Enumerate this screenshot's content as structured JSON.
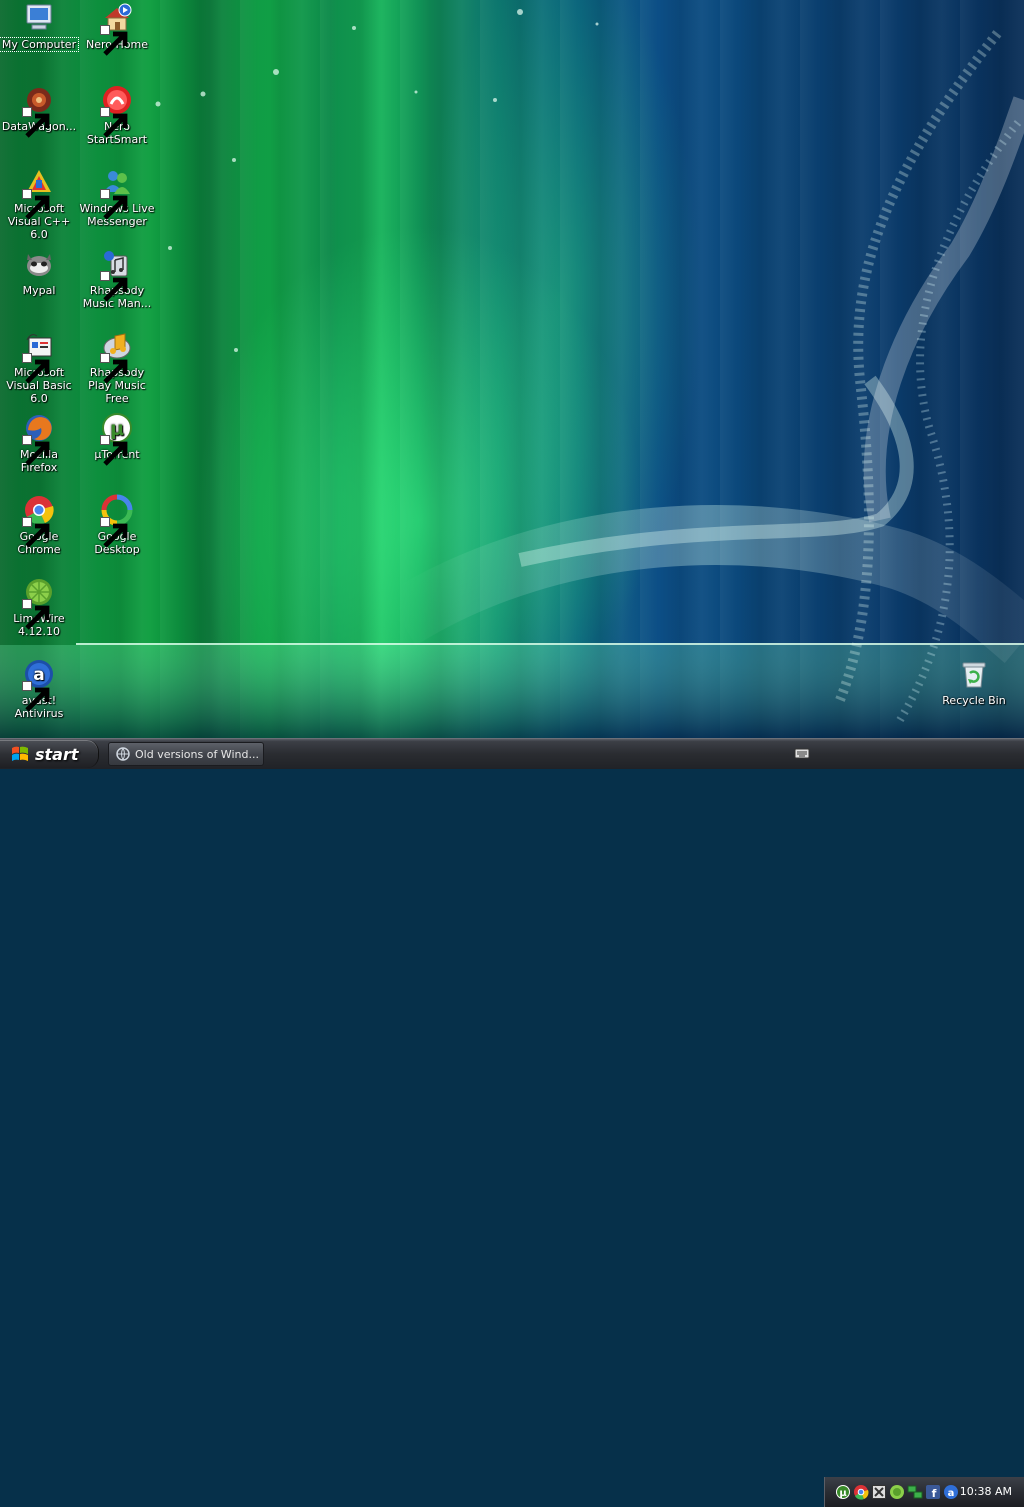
{
  "desktop": {
    "icons": [
      {
        "label": "My Computer",
        "icon": "my-computer-icon",
        "shortcut": false,
        "selected": true
      },
      {
        "label": "Nero Home",
        "icon": "nero-home-icon",
        "shortcut": true
      },
      {
        "label": "DataWagon...",
        "icon": "datawagon-icon",
        "shortcut": true
      },
      {
        "label": "Nero StartSmart",
        "icon": "nero-startsmart-icon",
        "shortcut": true
      },
      {
        "label": "Microsoft Visual C++ 6.0",
        "icon": "visual-cpp-icon",
        "shortcut": true
      },
      {
        "label": "Windows Live Messenger",
        "icon": "windows-live-messenger-icon",
        "shortcut": true
      },
      {
        "label": "Mypal",
        "icon": "mypal-icon",
        "shortcut": false
      },
      {
        "label": "Rhapsody Music Man...",
        "icon": "rhapsody-music-manager-icon",
        "shortcut": true
      },
      {
        "label": "Microsoft Visual Basic 6.0",
        "icon": "visual-basic-icon",
        "shortcut": true
      },
      {
        "label": "Rhapsody Play Music Free",
        "icon": "rhapsody-play-icon",
        "shortcut": true
      },
      {
        "label": "Mozilla Firefox",
        "icon": "firefox-icon",
        "shortcut": true
      },
      {
        "label": "µTorrent",
        "icon": "utorrent-icon",
        "shortcut": true
      },
      {
        "label": "Google Chrome",
        "icon": "chrome-icon",
        "shortcut": true
      },
      {
        "label": "Google Desktop",
        "icon": "google-desktop-icon",
        "shortcut": true
      },
      {
        "label": "LimeWire 4.12.10",
        "icon": "limewire-icon",
        "shortcut": true
      },
      {
        "label": "avast! Antivirus",
        "icon": "avast-icon",
        "shortcut": true
      },
      {
        "label": "Recycle Bin",
        "icon": "recycle-bin-icon",
        "shortcut": false
      }
    ]
  },
  "taskbar": {
    "start_label": "start",
    "tasks": [
      {
        "label": "Old versions of Wind...",
        "icon": "browser-window-icon"
      }
    ],
    "tray_icons": [
      "keyboard-icon",
      "utorrent-tray-icon",
      "chrome-tray-icon",
      "xcross-tray-icon",
      "limewire-tray-icon",
      "network-tray-icon",
      "facebook-tray-icon",
      "avast-tray-icon"
    ],
    "clock": "10:38 AM"
  },
  "colors": {
    "taskbar": "#2a2c31",
    "desktop_green": "#0f9e40",
    "desktop_blue": "#0b4a7e"
  }
}
